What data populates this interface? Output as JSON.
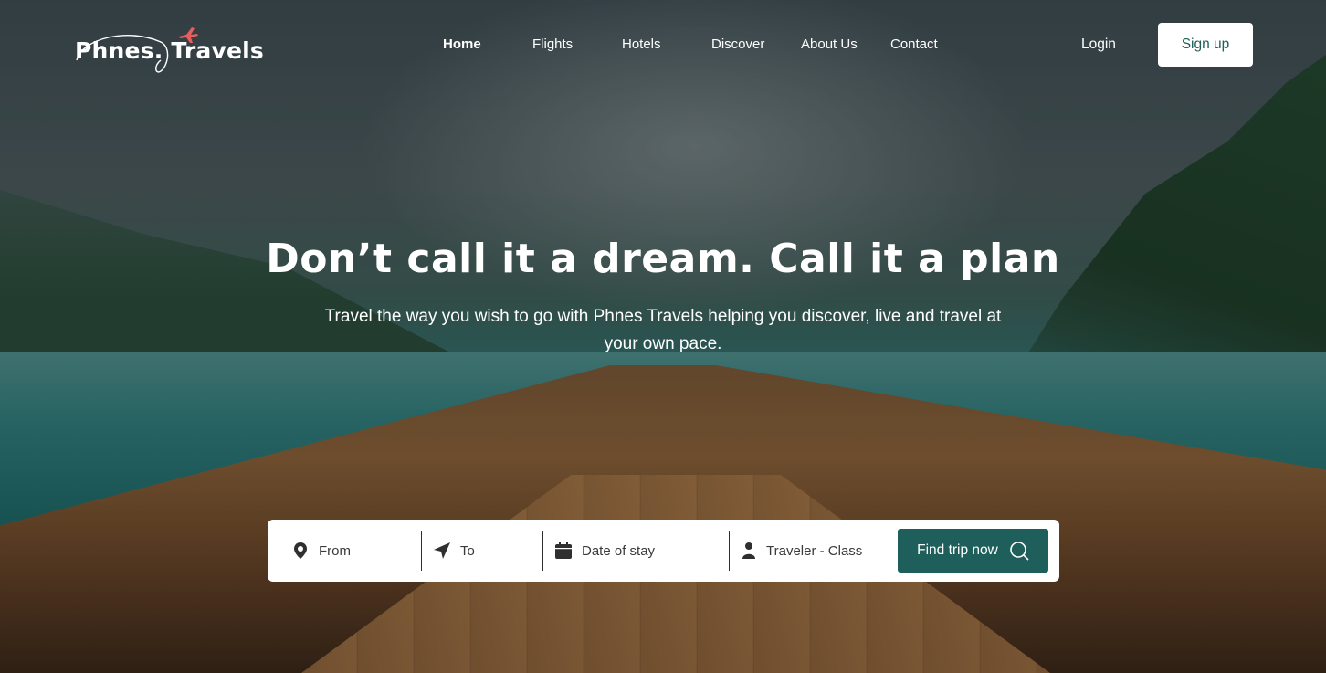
{
  "brand": {
    "name": "Phnes. Travels",
    "accent_color": "#e85d5d"
  },
  "nav": {
    "items": [
      {
        "label": "Home"
      },
      {
        "label": "Flights"
      },
      {
        "label": "Hotels"
      },
      {
        "label": "Discover"
      },
      {
        "label": "About Us"
      },
      {
        "label": "Contact"
      }
    ],
    "login_label": "Login",
    "signup_label": "Sign up"
  },
  "hero": {
    "headline": "Don’t call it a dream. Call it a plan",
    "subtitle": "Travel the way you wish to go with Phnes Travels helping you discover, live and travel at your own pace."
  },
  "search": {
    "from_label": "From",
    "to_label": "To",
    "date_label": "Date of stay",
    "traveler_label": "Traveler - Class",
    "submit_label": "Find trip now",
    "icons": [
      "map-pin-icon",
      "navigation-arrow-icon",
      "calendar-icon",
      "person-icon",
      "search-icon"
    ]
  },
  "colors": {
    "primary": "#1e5f5b",
    "signup_text": "#1d5f5a",
    "white": "#ffffff"
  }
}
